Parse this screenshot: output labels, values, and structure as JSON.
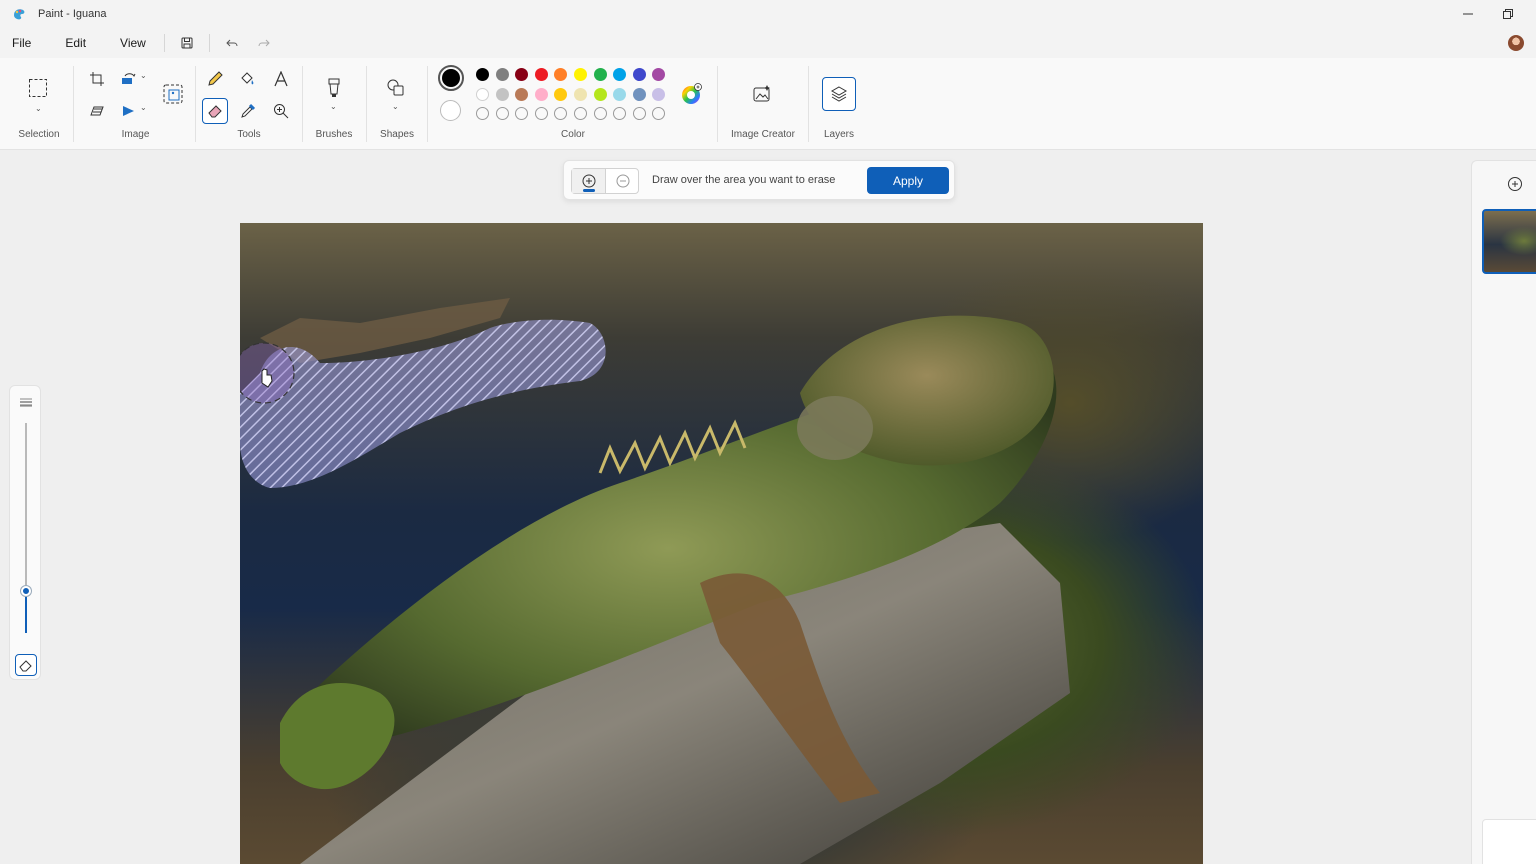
{
  "window": {
    "title": "Paint - Iguana"
  },
  "menu": {
    "file": "File",
    "edit": "Edit",
    "view": "View"
  },
  "ribbon": {
    "selection_label": "Selection",
    "image_label": "Image",
    "tools_label": "Tools",
    "brushes_label": "Brushes",
    "shapes_label": "Shapes",
    "color_label": "Color",
    "image_creator_label": "Image Creator",
    "layers_label": "Layers"
  },
  "colors": {
    "primary": "#000000",
    "secondary": "#ffffff",
    "row1": [
      "#000000",
      "#7f7f7f",
      "#880015",
      "#ed1c24",
      "#ff7f27",
      "#fff200",
      "#22b14c",
      "#00a2e8",
      "#3f48cc",
      "#a349a4"
    ],
    "row2": [
      "#ffffff",
      "#c3c3c3",
      "#b97a57",
      "#ffaec9",
      "#ffc90e",
      "#efe4b0",
      "#b5e61d",
      "#99d9ea",
      "#7092be",
      "#c8bfe7"
    ],
    "accent": "#0f5fb8"
  },
  "erase_bar": {
    "hint": "Draw over the area you want to erase",
    "apply": "Apply"
  },
  "brush_size_level": 0.2
}
